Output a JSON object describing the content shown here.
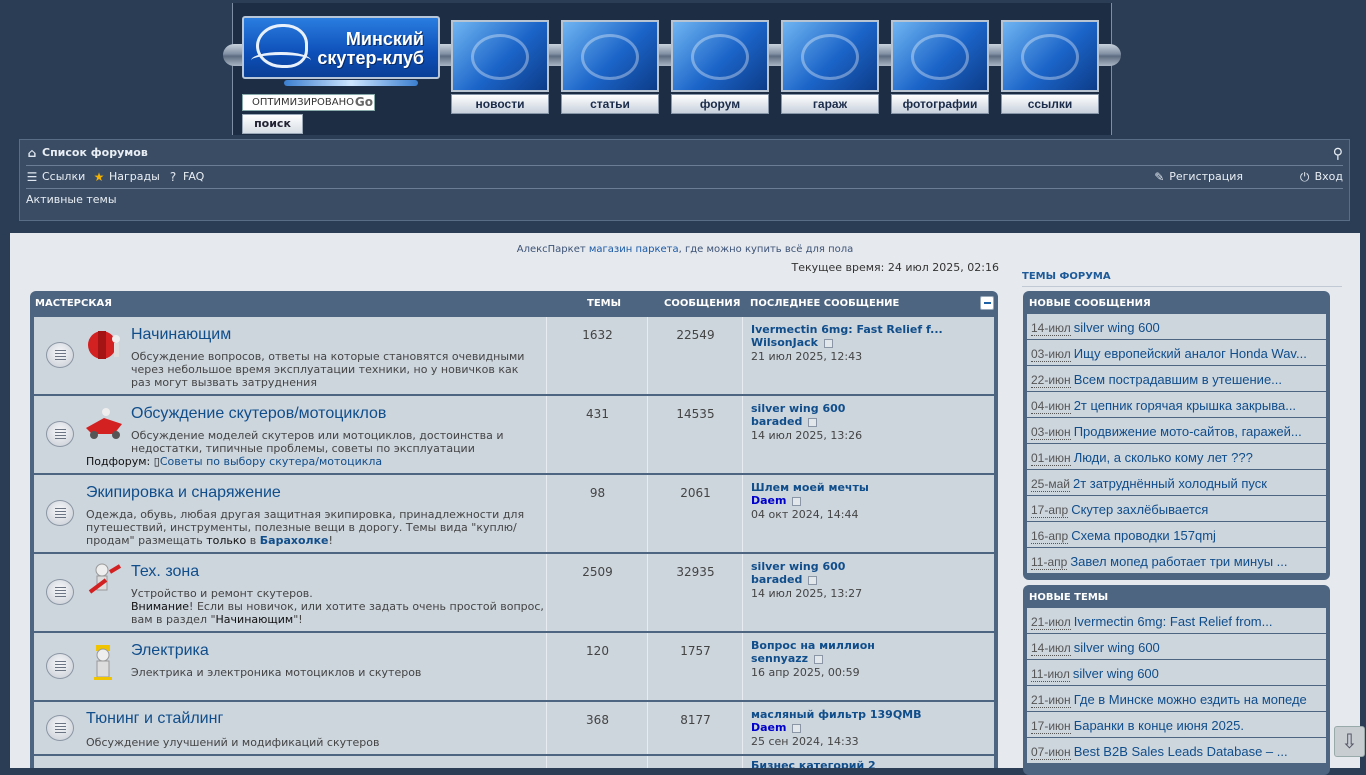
{
  "header": {
    "logo_line1": "Минский",
    "logo_line2": "скутер-клуб",
    "search_placeholder": "ОПТИМИЗИРОВАНО",
    "search_brand": "Go",
    "search_button": "поиск",
    "nav": [
      {
        "label": "новости"
      },
      {
        "label": "статьи"
      },
      {
        "label": "форум"
      },
      {
        "label": "гараж"
      },
      {
        "label": "фотографии"
      },
      {
        "label": "ссылки"
      }
    ]
  },
  "navbar": {
    "forum_index": "Список форумов",
    "links": "Ссылки",
    "awards": "Награды",
    "faq": "FAQ",
    "register": "Регистрация",
    "login": "Вход",
    "active_topics": "Активные темы"
  },
  "promo": {
    "prefix": "АлексПаркет",
    "link": "магазин паркета",
    "suffix": ", где можно купить всё для пола"
  },
  "current_time": "Текущее время: 24 июл 2025, 02:16",
  "forum_table": {
    "category": "МАСТЕРСКАЯ",
    "col_topics": "ТЕМЫ",
    "col_posts": "СООБЩЕНИЯ",
    "col_last": "ПОСЛЕДНЕЕ СООБЩЕНИЕ",
    "rows": [
      {
        "title": "Начинающим",
        "desc": "Обсуждение вопросов, ответы на которые становятся очевидными через небольшое время эксплуатации техники, но у новичков как раз могут вызвать затруднения",
        "topics": "1632",
        "posts": "22549",
        "last_title": "Ivermectin 6mg: Fast Relief f...",
        "last_user": "WilsonJack",
        "last_time": "21 июл 2025, 12:43"
      },
      {
        "title": "Обсуждение скутеров/мотоциклов",
        "desc": "Обсуждение моделей скутеров или мотоциклов, достоинства и недостатки, типичные проблемы, советы по эксплуатации",
        "sub_label": "Подфорум:",
        "sub_link": "Советы по выбору скутера/мотоцикла",
        "topics": "431",
        "posts": "14535",
        "last_title": "silver wing 600",
        "last_user": "baraded",
        "last_time": "14 июл 2025, 13:26"
      },
      {
        "title": "Экипировка и снаряжение",
        "desc": "Одежда, обувь, любая другая защитная экипировка, принадлежности для путешествий, инструменты, полезные вещи в дорогу. Темы вида \"куплю/продам\" размещать",
        "desc_only": "только",
        "desc_in": "в",
        "desc_link": "Барахолке",
        "desc_end": "!",
        "topics": "98",
        "posts": "2061",
        "last_title": "Шлем моей мечты",
        "last_user": "Daem",
        "last_time": "04 окт 2024, 14:44"
      },
      {
        "title": "Тех. зона",
        "desc": "Устройство и ремонт скутеров.",
        "desc_warn": "Внимание",
        "desc2": "! Если вы новичок, или хотите задать очень простой вопрос, вам в раздел \"",
        "desc_link": "Начинающим",
        "desc_end": "\"!",
        "topics": "2509",
        "posts": "32935",
        "last_title": "silver wing 600",
        "last_user": "baraded",
        "last_time": "14 июл 2025, 13:27"
      },
      {
        "title": "Электрика",
        "desc": "Электрика и электроника мотоциклов и скутеров",
        "topics": "120",
        "posts": "1757",
        "last_title": "Вопрос на миллион",
        "last_user": "sennyazz",
        "last_time": "16 апр 2025, 00:59"
      },
      {
        "title": "Тюнинг и стайлинг",
        "desc": "Обсуждение улучшений и модификаций скутеров",
        "topics": "368",
        "posts": "8177",
        "last_title": "масляный фильтр 139QMB",
        "last_user": "Daem",
        "last_time": "25 сен 2024, 14:33"
      }
    ],
    "partial_last": "Бизнес категорий 2"
  },
  "sidebar": {
    "title": "ТЕМЫ ФОРУМА",
    "new_posts_title": "НОВЫЕ СООБЩЕНИЯ",
    "new_posts": [
      {
        "date": "14-июл",
        "title": "silver wing 600"
      },
      {
        "date": "03-июл",
        "title": "Ищу европейский аналог Honda Wav..."
      },
      {
        "date": "22-июн",
        "title": "Всем пострадавшим в утешение..."
      },
      {
        "date": "04-июн",
        "title": "2т цепник горячая крышка закрыва..."
      },
      {
        "date": "03-июн",
        "title": "Продвижение мото-сайтов, гаражей..."
      },
      {
        "date": "01-июн",
        "title": "Люди, а сколько кому лет ???"
      },
      {
        "date": "25-май",
        "title": "2т затруднённый холодный пуск"
      },
      {
        "date": "17-апр",
        "title": "Скутер захлёбывается"
      },
      {
        "date": "16-апр",
        "title": "Схема проводки 157qmj"
      },
      {
        "date": "11-апр",
        "title": "Завел мопед работает три минуы ..."
      }
    ],
    "new_topics_title": "НОВЫЕ ТЕМЫ",
    "new_topics": [
      {
        "date": "21-июл",
        "title": "Ivermectin 6mg: Fast Relief from..."
      },
      {
        "date": "14-июл",
        "title": "silver wing 600"
      },
      {
        "date": "11-июл",
        "title": "silver wing 600"
      },
      {
        "date": "21-июн",
        "title": "Где в Минске можно ездить на мопеде"
      },
      {
        "date": "17-июн",
        "title": "Баранки в конце июня 2025."
      },
      {
        "date": "07-июн",
        "title": "Best B2B Sales Leads Database – ..."
      }
    ]
  },
  "scroll_glyph": "⇩"
}
